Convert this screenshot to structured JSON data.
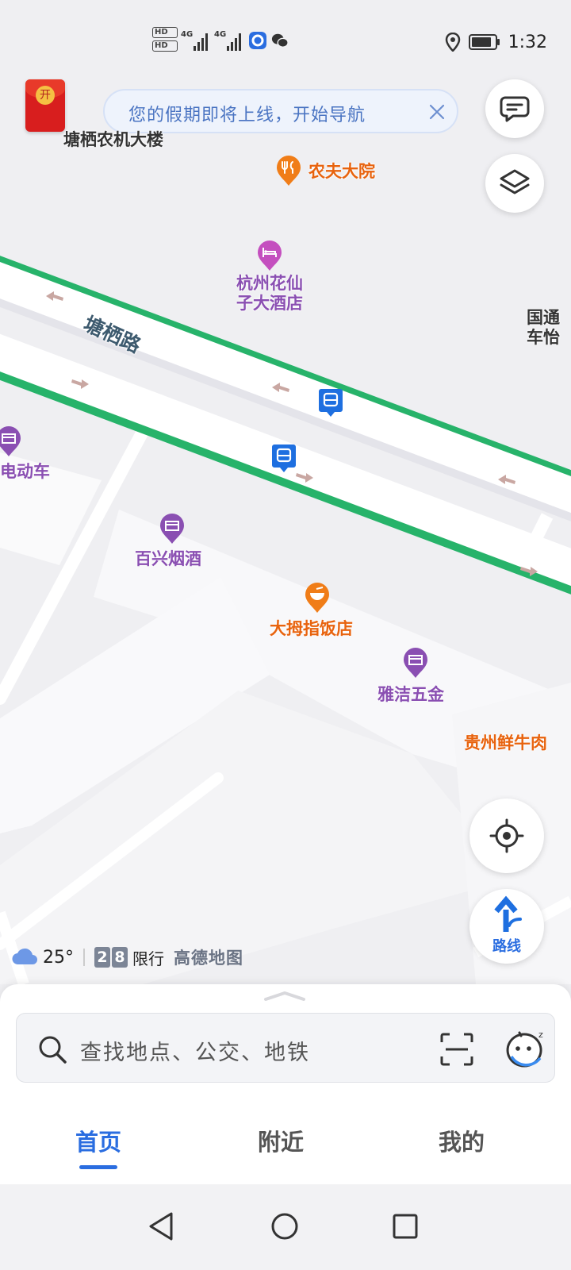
{
  "status_bar": {
    "hd1": "HD",
    "hd2": "HD",
    "net1": "4G",
    "net2": "4G",
    "time": "1:32",
    "icons": [
      "location-icon",
      "battery-icon",
      "wechat-icon",
      "app-icon"
    ]
  },
  "banner": {
    "text": "您的假期即将上线，开始导航",
    "close_icon": "close-icon"
  },
  "redpacket": {
    "char": "开"
  },
  "map": {
    "road_name": "塘栖路",
    "pois": [
      {
        "name": "塘栖农机大楼",
        "color": "dark"
      },
      {
        "name": "农夫大院",
        "color": "orange",
        "icon": "restaurant-icon"
      },
      {
        "name": "杭州花仙子大酒店",
        "color": "purple",
        "icon": "hotel-icon"
      },
      {
        "name": "国通车怡",
        "color": "dark"
      },
      {
        "name": "电动车",
        "color": "purple",
        "icon": "shop-icon"
      },
      {
        "name": "百兴烟酒",
        "color": "purple",
        "icon": "shop-icon"
      },
      {
        "name": "大拇指饭店",
        "color": "orange",
        "icon": "restaurant-icon"
      },
      {
        "name": "雅洁五金",
        "color": "purple",
        "icon": "shop-icon"
      },
      {
        "name": "贵州鲜牛肉",
        "color": "orange"
      }
    ],
    "colors": {
      "road_highlight": "#27b36a",
      "road": "#ffffff",
      "block": "#fafafb",
      "base": "#eeeef1"
    }
  },
  "footer": {
    "temperature": "25°",
    "plate_1": "2",
    "plate_2": "8",
    "limit_label": "限行",
    "brand": "高德地图"
  },
  "right_controls": {
    "route_label": "路线"
  },
  "search": {
    "placeholder": "查找地点、公交、地铁"
  },
  "tabs": [
    {
      "label": "首页",
      "active": true
    },
    {
      "label": "附近",
      "active": false
    },
    {
      "label": "我的",
      "active": false
    }
  ],
  "accent_color": "#2a6de0"
}
